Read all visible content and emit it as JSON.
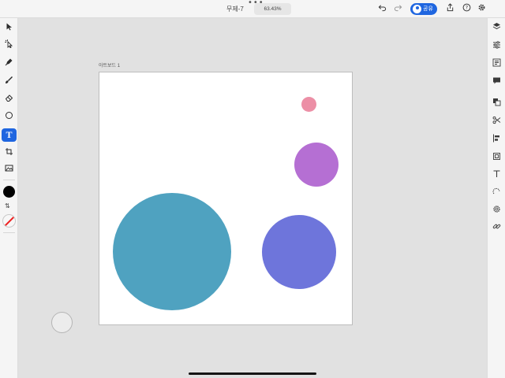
{
  "topbar": {
    "menu_dots": "•••",
    "doc_title": "무제-7",
    "zoom": "63.43%",
    "undo_icon": "undo-icon",
    "redo_icon": "redo-icon",
    "share_label": "공유",
    "share_icon": "person-icon",
    "export_icon": "export-icon",
    "help_icon": "help-icon",
    "settings_icon": "gear-icon"
  },
  "left_toolbar": {
    "tools": [
      {
        "name": "select-tool",
        "icon": "arrow-icon"
      },
      {
        "name": "direct-select-tool",
        "icon": "magic-select-icon"
      },
      {
        "name": "pen-tool",
        "icon": "pen-icon"
      },
      {
        "name": "brush-tool",
        "icon": "brush-icon"
      },
      {
        "name": "eraser-tool",
        "icon": "eraser-icon"
      },
      {
        "name": "shape-tool",
        "icon": "ellipse-icon"
      },
      {
        "name": "text-tool",
        "icon": "text-icon",
        "label": "T",
        "active": true
      },
      {
        "name": "artboard-tool",
        "icon": "artboard-icon"
      },
      {
        "name": "image-tool",
        "icon": "image-icon"
      }
    ],
    "fill_color": "#000000",
    "stroke_color": "none"
  },
  "right_panel": {
    "icons": [
      "layers-icon",
      "properties-icon",
      "libraries-icon",
      "comments-icon",
      "arrange-icon",
      "scissors-icon",
      "align-icon",
      "transform-icon",
      "type-icon",
      "repeat-icon",
      "settings-cog-icon",
      "link-icon"
    ]
  },
  "artboard": {
    "label": "아트보드 1",
    "shapes": [
      {
        "name": "pink-circle",
        "color": "#ec8fa6"
      },
      {
        "name": "purple-circle",
        "color": "#b56fd3"
      },
      {
        "name": "indigo-circle",
        "color": "#6e75db"
      },
      {
        "name": "teal-circle",
        "color": "#4fa2c0"
      }
    ]
  },
  "colors": {
    "accent": "#1f66e0",
    "canvas_background": "#e1e1e1"
  }
}
